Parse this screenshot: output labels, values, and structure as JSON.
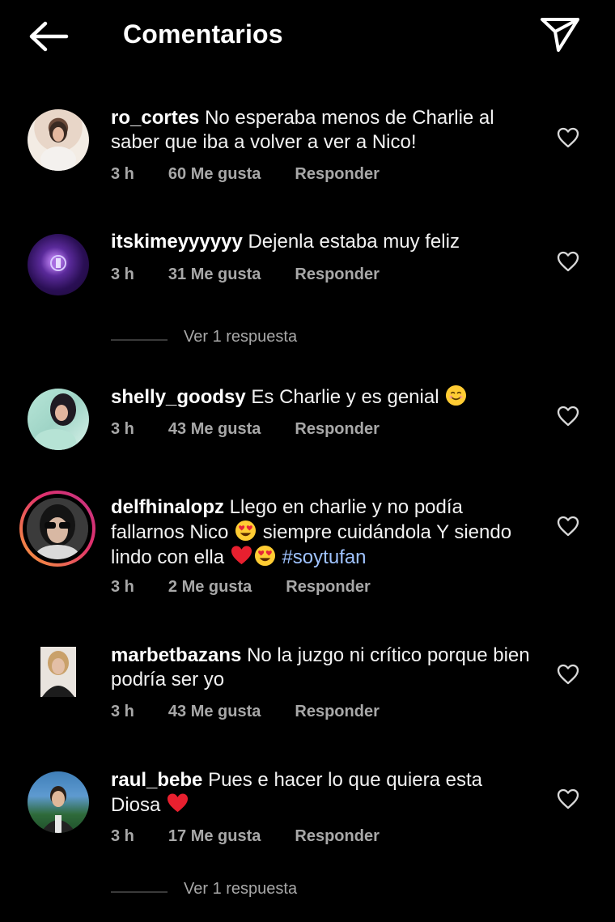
{
  "header": {
    "title": "Comentarios",
    "back_icon": "arrow-left-icon",
    "share_icon": "paper-plane-icon"
  },
  "colors": {
    "background": "#000000",
    "meta_text": "#a8a8a8",
    "hashtag": "#9fc3ff",
    "story_ring_start": "#f9a13a",
    "story_ring_end": "#d62976"
  },
  "comments": [
    {
      "username": "ro_cortes",
      "text": "No esperaba menos de Charlie al saber que iba a volver a ver a Nico!",
      "time": "3 h",
      "likes": "60 Me gusta",
      "reply": "Responder"
    },
    {
      "username": "itskimeyyyyyy",
      "text": "Dejenla estaba muy feliz",
      "time": "3 h",
      "likes": "31 Me gusta",
      "reply": "Responder",
      "view_replies": "Ver 1 respuesta"
    },
    {
      "username": "shelly_goodsy",
      "text": "Es Charlie y es genial",
      "emoji": "smiling-face-emoji",
      "time": "3 h",
      "likes": "43 Me gusta",
      "reply": "Responder"
    },
    {
      "username": "delfhinalopz",
      "text_1": "Llego en charlie y no podía fallarnos Nico",
      "text_2": "siempre cuidándola Y siendo lindo con ella",
      "hashtag": "#soytufan",
      "time": "3 h",
      "likes": "2 Me gusta",
      "reply": "Responder"
    },
    {
      "username": "marbetbazans",
      "text": "No la juzgo ni crítico porque bien podría ser yo",
      "time": "3 h",
      "likes": "43 Me gusta",
      "reply": "Responder"
    },
    {
      "username": "raul_bebe",
      "text": "Pues e hacer lo que quiera esta Diosa",
      "emoji": "red-heart-emoji",
      "time": "3 h",
      "likes": "17 Me gusta",
      "reply": "Responder",
      "view_replies": "Ver 1 respuesta"
    }
  ]
}
